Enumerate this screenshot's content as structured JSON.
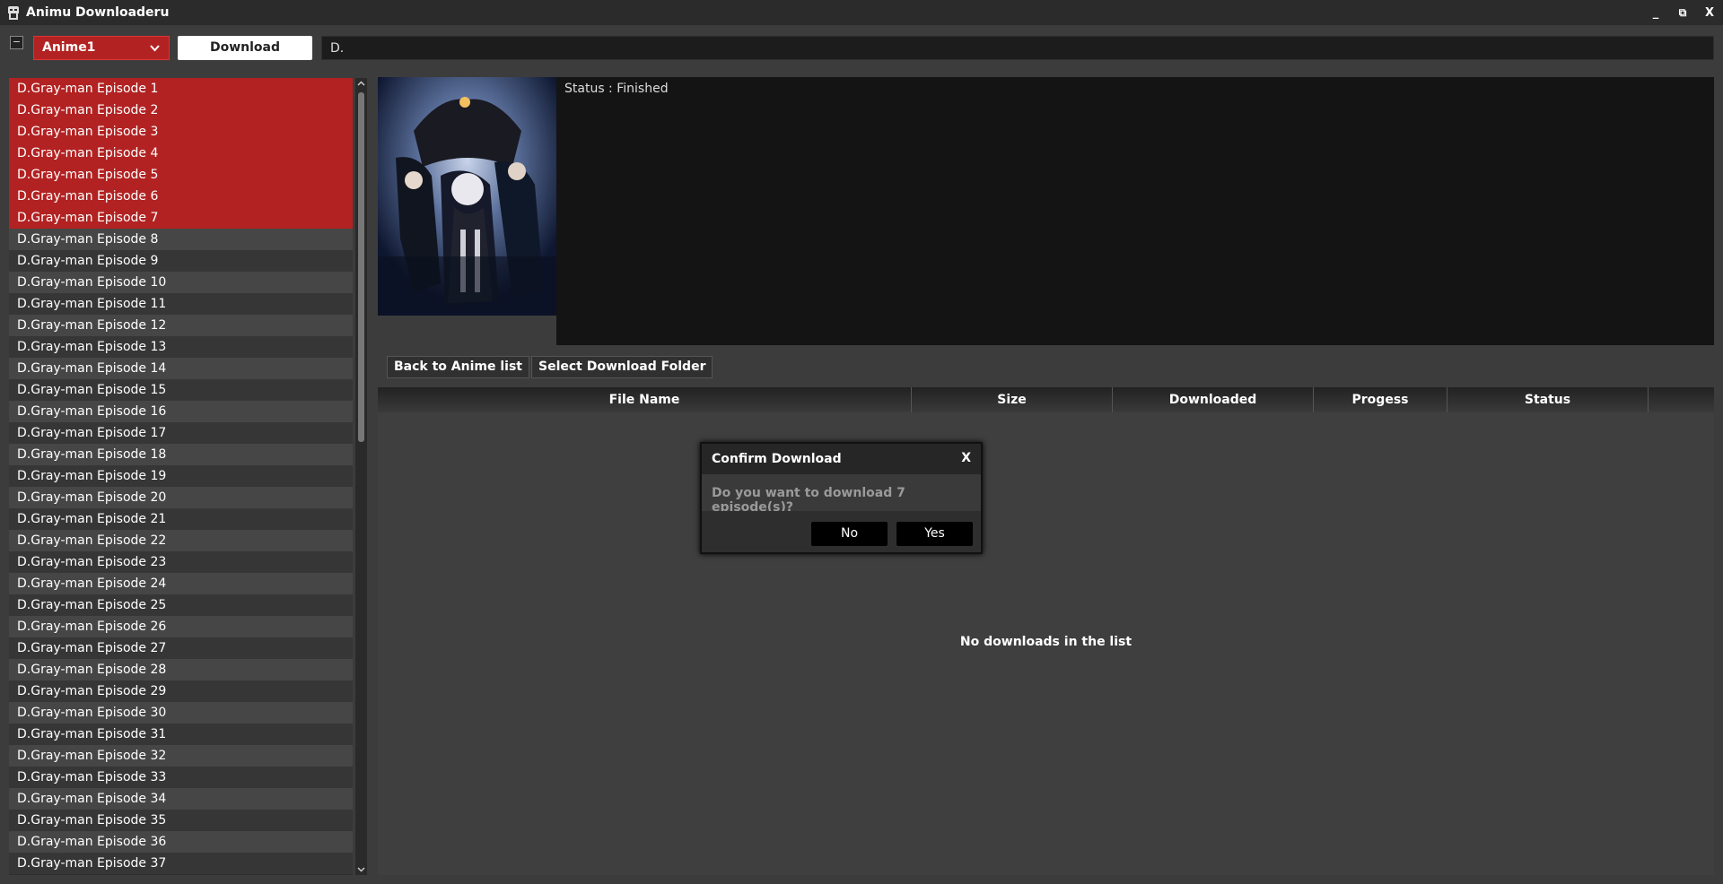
{
  "window": {
    "title": "Animu Downloaderu",
    "minimize": "_",
    "maximize": "⧉",
    "close": "X"
  },
  "toolbar": {
    "collapse_label": "−",
    "source_selected": "Anime1",
    "download_label": "Download",
    "search_value": "D."
  },
  "episodes": [
    {
      "label": "D.Gray-man Episode 1",
      "selected": true
    },
    {
      "label": "D.Gray-man Episode 2",
      "selected": true
    },
    {
      "label": "D.Gray-man Episode 3",
      "selected": true
    },
    {
      "label": "D.Gray-man Episode 4",
      "selected": true
    },
    {
      "label": "D.Gray-man Episode 5",
      "selected": true
    },
    {
      "label": "D.Gray-man Episode 6",
      "selected": true
    },
    {
      "label": "D.Gray-man Episode 7",
      "selected": true
    },
    {
      "label": "D.Gray-man Episode 8",
      "selected": false
    },
    {
      "label": "D.Gray-man Episode 9",
      "selected": false
    },
    {
      "label": "D.Gray-man Episode 10",
      "selected": false
    },
    {
      "label": "D.Gray-man Episode 11",
      "selected": false
    },
    {
      "label": "D.Gray-man Episode 12",
      "selected": false
    },
    {
      "label": "D.Gray-man Episode 13",
      "selected": false
    },
    {
      "label": "D.Gray-man Episode 14",
      "selected": false
    },
    {
      "label": "D.Gray-man Episode 15",
      "selected": false
    },
    {
      "label": "D.Gray-man Episode 16",
      "selected": false
    },
    {
      "label": "D.Gray-man Episode 17",
      "selected": false
    },
    {
      "label": "D.Gray-man Episode 18",
      "selected": false
    },
    {
      "label": "D.Gray-man Episode 19",
      "selected": false
    },
    {
      "label": "D.Gray-man Episode 20",
      "selected": false
    },
    {
      "label": "D.Gray-man Episode 21",
      "selected": false
    },
    {
      "label": "D.Gray-man Episode 22",
      "selected": false
    },
    {
      "label": "D.Gray-man Episode 23",
      "selected": false
    },
    {
      "label": "D.Gray-man Episode 24",
      "selected": false
    },
    {
      "label": "D.Gray-man Episode 25",
      "selected": false
    },
    {
      "label": "D.Gray-man Episode 26",
      "selected": false
    },
    {
      "label": "D.Gray-man Episode 27",
      "selected": false
    },
    {
      "label": "D.Gray-man Episode 28",
      "selected": false
    },
    {
      "label": "D.Gray-man Episode 29",
      "selected": false
    },
    {
      "label": "D.Gray-man Episode 30",
      "selected": false
    },
    {
      "label": "D.Gray-man Episode 31",
      "selected": false
    },
    {
      "label": "D.Gray-man Episode 32",
      "selected": false
    },
    {
      "label": "D.Gray-man Episode 33",
      "selected": false
    },
    {
      "label": "D.Gray-man Episode 34",
      "selected": false
    },
    {
      "label": "D.Gray-man Episode 35",
      "selected": false
    },
    {
      "label": "D.Gray-man Episode 36",
      "selected": false
    },
    {
      "label": "D.Gray-man Episode 37",
      "selected": false
    }
  ],
  "info": {
    "status": "Status : Finished"
  },
  "actions": {
    "back_label": "Back to Anime list",
    "folder_label": "Select Download Folder"
  },
  "table": {
    "columns": [
      "File Name",
      "Size",
      "Downloaded",
      "Progess",
      "Status",
      ""
    ],
    "empty_message": "No downloads in the list"
  },
  "dialog": {
    "title": "Confirm Download",
    "close": "X",
    "message": "Do you want to download 7 episode(s)?",
    "no_label": "No",
    "yes_label": "Yes"
  },
  "colors": {
    "accent": "#b22222",
    "background": "#3c3c3c",
    "titlebar": "#2b2b2b"
  }
}
